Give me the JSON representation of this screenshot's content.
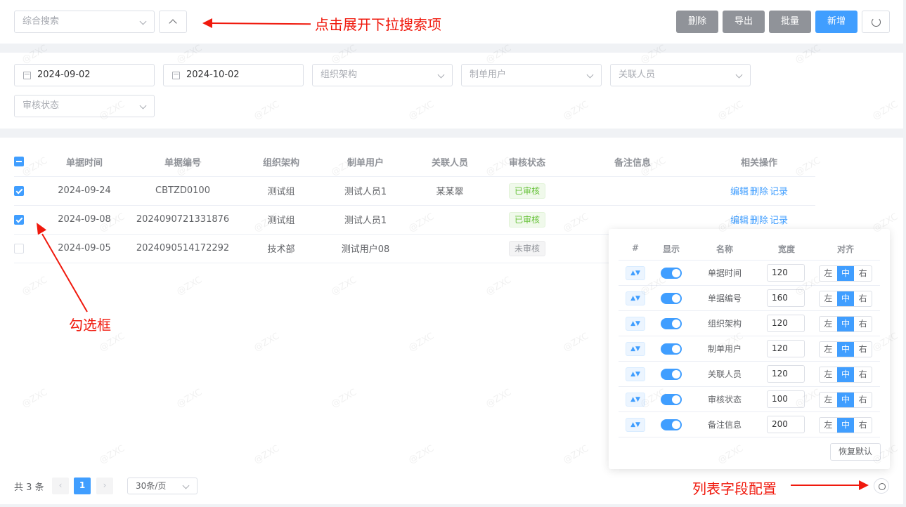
{
  "search": {
    "combo_placeholder": "综合搜索"
  },
  "toolbar": {
    "delete": "删除",
    "export": "导出",
    "batch": "批量",
    "add": "新增"
  },
  "annotations": {
    "expand": "点击展开下拉搜索项",
    "checkbox": "勾选框",
    "column_config": "列表字段配置"
  },
  "filters": {
    "start_date": "2024-09-02",
    "end_date": "2024-10-02",
    "org": "组织架构",
    "creator": "制单用户",
    "related": "关联人员",
    "status": "审核状态"
  },
  "table": {
    "headers": [
      "单据时间",
      "单据编号",
      "组织架构",
      "制单用户",
      "关联人员",
      "审核状态",
      "备注信息",
      "相关操作"
    ],
    "rows": [
      {
        "checked": true,
        "date": "2024-09-24",
        "no": "CBTZD0100",
        "org": "测试组",
        "user": "测试人员1",
        "related": "某某翠",
        "status": "已审核",
        "remark": ""
      },
      {
        "checked": true,
        "date": "2024-09-08",
        "no": "2024090721331876",
        "org": "测试组",
        "user": "测试人员1",
        "related": "",
        "status": "已审核",
        "remark": ""
      },
      {
        "checked": false,
        "date": "2024-09-05",
        "no": "2024090514172292",
        "org": "技术部",
        "user": "测试用户08",
        "related": "",
        "status": "未审核",
        "remark": ""
      }
    ],
    "ops": {
      "edit": "编辑",
      "delete": "删除",
      "log": "记录"
    }
  },
  "column_config": {
    "headers": {
      "index": "#",
      "show": "显示",
      "name": "名称",
      "width": "宽度",
      "align": "对齐"
    },
    "align_labels": {
      "left": "左",
      "center": "中",
      "right": "右"
    },
    "rows": [
      {
        "name": "单据时间",
        "width": "120"
      },
      {
        "name": "单据编号",
        "width": "160"
      },
      {
        "name": "组织架构",
        "width": "120"
      },
      {
        "name": "制单用户",
        "width": "120"
      },
      {
        "name": "关联人员",
        "width": "120"
      },
      {
        "name": "审核状态",
        "width": "100"
      },
      {
        "name": "备注信息",
        "width": "200"
      }
    ],
    "reset": "恢复默认"
  },
  "pager": {
    "total": "共 3 条",
    "current": "1",
    "size": "30条/页"
  },
  "watermark": "@ZXC",
  "colors": {
    "primary": "#409eff",
    "gray_btn": "#909399",
    "annotation": "#f0190d"
  }
}
